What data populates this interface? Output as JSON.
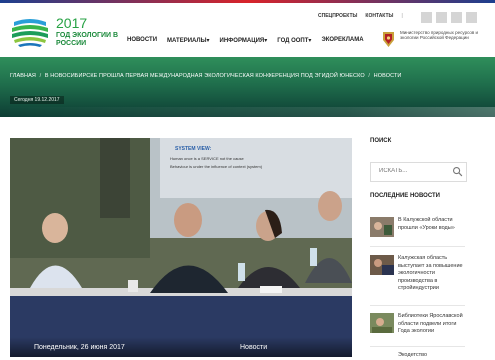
{
  "header": {
    "logo": {
      "year": "2017",
      "title": "ГОД ЭКОЛОГИИ В РОССИИ",
      "icon": "ecology-year-logo"
    },
    "top_nav": [
      "СПЕЦПРОЕКТЫ",
      "КОНТАКТЫ"
    ],
    "social_icons": [
      "social-icon-1",
      "social-icon-2",
      "social-icon-3",
      "social-icon-4"
    ],
    "main_nav": [
      {
        "label": "НОВОСТИ"
      },
      {
        "label": "МАТЕРИАЛЫ▾"
      },
      {
        "label": "ИНФОРМАЦИЯ▾"
      },
      {
        "label": "ГОД ООПТ▾"
      },
      {
        "label": "ЭКОРЕКЛАМА"
      }
    ],
    "ministry": {
      "text": "Министерство природных ресурсов и экологии Российской Федерации",
      "icon": "coat-of-arms-icon"
    }
  },
  "hero": {
    "breadcrumb": [
      "ГЛАВНАЯ",
      "В НОВОСИБИРСКЕ ПРОШЛА ПЕРВАЯ МЕЖДУНАРОДНАЯ ЭКОЛОГИЧЕСКАЯ КОНФЕРЕНЦИЯ ПОД ЭГИДОЙ ЮНЕСКО",
      "НОВОСТИ"
    ],
    "breadcrumb_separator": "/",
    "today_label": "Сегодня 19.12.2017",
    "colors": {
      "hero_top": "#2f8f5b",
      "hero_bottom": "#0d3d34"
    }
  },
  "article": {
    "image": "conference-photo",
    "date": "Понедельник, 26 июня 2017",
    "category": "Новости",
    "screen_text": [
      "SYSTEM VIEW:",
      "Human once is a SERVICE not the cause",
      "Behaviour is under the influence of context (system)"
    ]
  },
  "sidebar": {
    "search_heading": "ПОИСК",
    "search_placeholder": "ИСКАТЬ...",
    "latest_heading": "ПОСЛЕДНИЕ НОВОСТИ",
    "news": [
      {
        "title": "В Калужской области прошли «Уроки воды»"
      },
      {
        "title": "Калужская область выступает за повышение экологичности производства в стройиндустрии"
      },
      {
        "title": "Библиотеки Ярославской области подвели итоги Года экологии"
      },
      {
        "title": "Экодетство"
      }
    ]
  }
}
